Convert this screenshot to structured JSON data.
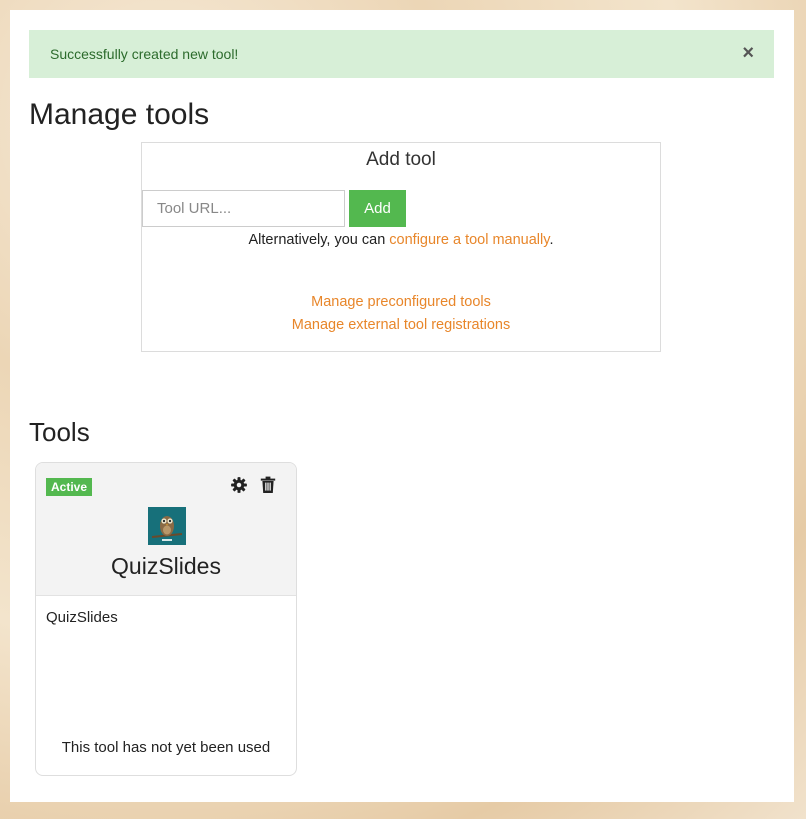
{
  "alert": {
    "message": "Successfully created new tool!",
    "close_symbol": "×"
  },
  "page": {
    "title": "Manage tools"
  },
  "add_tool": {
    "title": "Add tool",
    "url_placeholder": "Tool URL...",
    "url_value": "",
    "add_label": "Add",
    "alt_prefix": "Alternatively, you can ",
    "alt_link": "configure a tool manually",
    "alt_suffix": ".",
    "links": [
      "Manage preconfigured tools",
      "Manage external tool registrations"
    ]
  },
  "tools": {
    "heading": "Tools",
    "items": [
      {
        "status": "Active",
        "name": "QuizSlides",
        "description": "QuizSlides",
        "usage": "This tool has not yet been used",
        "actions": [
          "gear-icon",
          "trash-icon"
        ]
      }
    ]
  },
  "colors": {
    "accent_link": "#e8862a",
    "success": "#53b84f",
    "alert_bg": "#d7efd7"
  }
}
